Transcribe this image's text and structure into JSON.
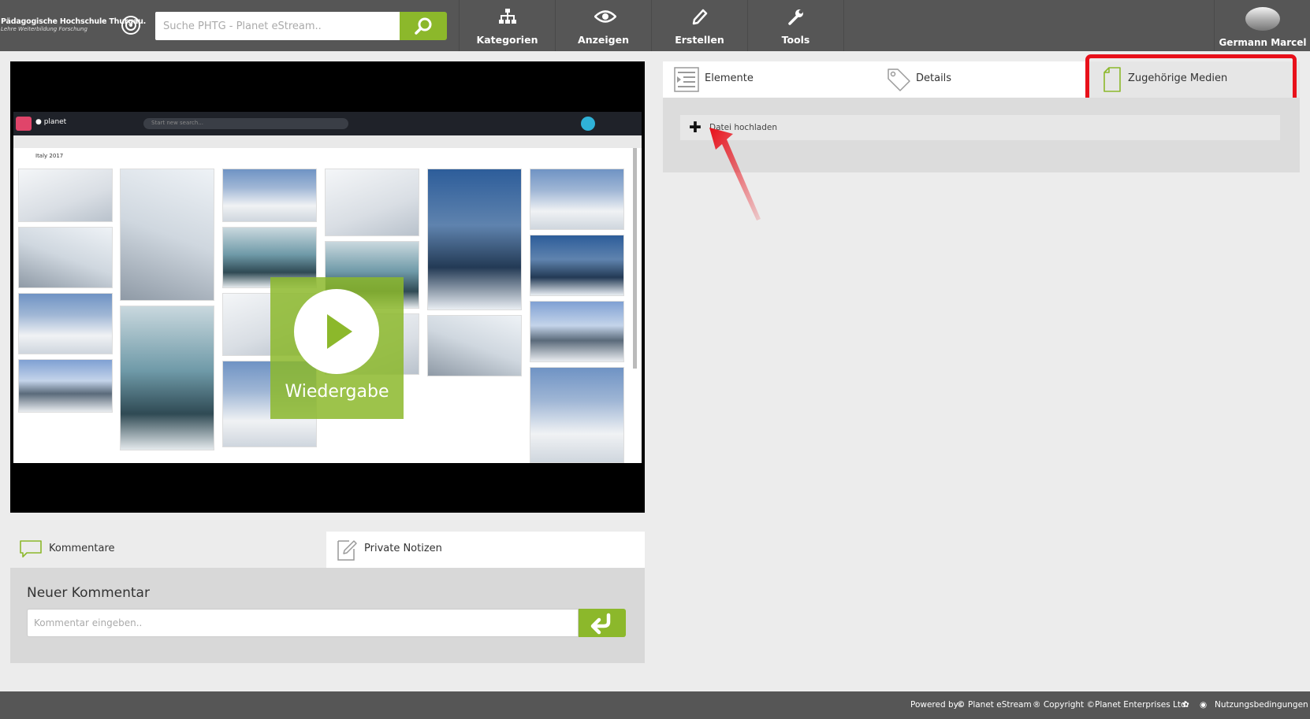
{
  "header": {
    "logo_title": "Pädagogische Hochschule Thurgau.",
    "logo_subtitle": "Lehre Weiterbildung Forschung",
    "search_placeholder": "Suche PHTG - Planet eStream..",
    "nav": [
      {
        "label": "Kategorien",
        "icon": "sitemap-icon"
      },
      {
        "label": "Anzeigen",
        "icon": "eye-icon"
      },
      {
        "label": "Erstellen",
        "icon": "pencil-icon"
      },
      {
        "label": "Tools",
        "icon": "wrench-icon"
      }
    ],
    "user_name": "Germann Marcel"
  },
  "video": {
    "play_label": "Wiedergabe",
    "inner_title": "Italy 2017",
    "inner_search_placeholder": "Start new search..."
  },
  "comments": {
    "tabs": [
      {
        "label": "Kommentare",
        "icon": "speech-bubble-icon"
      },
      {
        "label": "Private Notizen",
        "icon": "note-edit-icon"
      }
    ],
    "new_title": "Neuer Kommentar",
    "input_placeholder": "Kommentar eingeben.."
  },
  "right_tabs": [
    {
      "label": "Elemente",
      "icon": "list-icon"
    },
    {
      "label": "Details",
      "icon": "tag-icon"
    },
    {
      "label": "Zugehörige Medien",
      "icon": "document-icon",
      "active": true
    }
  ],
  "upload": {
    "label": "Datei hochladen"
  },
  "footer": {
    "powered_by": "Powered by",
    "brand": "Planet eStream",
    "copyright": "® Copyright ©Planet Enterprises Ltd",
    "terms": "Nutzungsbedingungen"
  },
  "colors": {
    "topbar": "#565656",
    "accent_green": "#8cb82b",
    "highlight_red": "#e8101a"
  }
}
